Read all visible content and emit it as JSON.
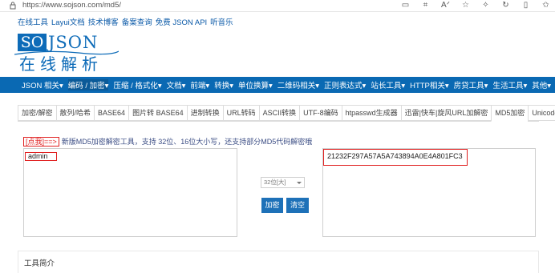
{
  "browser": {
    "url": "https://www.sojson.com/md5/",
    "icons": [
      "reader-mode-icon",
      "grid-icon",
      "font-size-icon",
      "favorite-star-icon",
      "puzzle-icon",
      "refresh-icon",
      "split-screen-icon",
      "favorites-icon"
    ]
  },
  "toplinks": [
    "在线工具",
    "Layui文档",
    "技术博客",
    "备案查询",
    "免费 JSON API",
    "听音乐"
  ],
  "logo": {
    "so": "SO",
    "json": "JSON",
    "cn": "在线解析"
  },
  "nav": [
    "JSON 相关▾",
    "编码 / 加密▾",
    "压缩 / 格式化▾",
    "文档▾",
    "前端▾",
    "转换▾",
    "单位换算▾",
    "二维码相关▾",
    "正则表达式▾",
    "站长工具▾",
    "HTTP相关▾",
    "房贷工具▾",
    "生活工具▾",
    "其他▾"
  ],
  "nav_active_index": 1,
  "tabs": [
    "加密/解密",
    "散列/哈希",
    "BASE64",
    "图片转 BASE64",
    "进制转换",
    "URL转码",
    "ASCII转换",
    "UTF-8编码",
    "htpasswd生成器",
    "迅雷|快车|旋风URL加解密",
    "MD5加密",
    "Unicode"
  ],
  "active_tab_index": 10,
  "hint": {
    "badge": "[点我]==>",
    "text": "新版MD5加密解密工具，支持 32位、16位大小写，还支持部分MD5代码解密哦"
  },
  "input": {
    "value": "admin"
  },
  "output": {
    "value": "21232F297A57A5A743894A0E4A801FC3"
  },
  "select": {
    "value": "32位[大]"
  },
  "buttons": {
    "encrypt": "加密",
    "clear": "清空"
  },
  "intro": {
    "title": "工具简介"
  },
  "colors": {
    "brand": "#0a69b3",
    "highlight": "#e02020",
    "button": "#1e71b8"
  }
}
